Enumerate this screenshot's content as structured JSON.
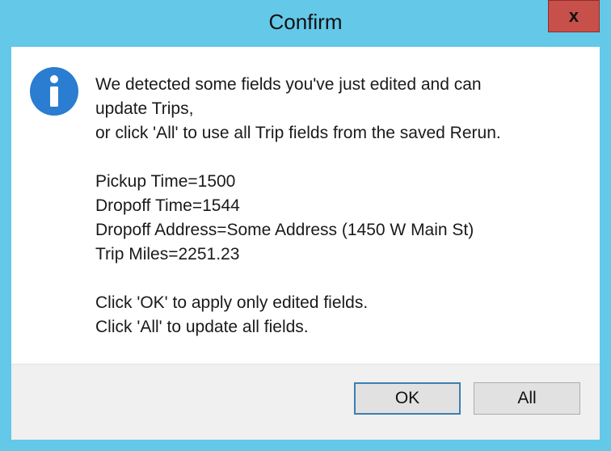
{
  "window": {
    "title": "Confirm",
    "close_glyph": "x"
  },
  "icon": {
    "name": "info-icon",
    "color": "#2a7dd1"
  },
  "message": {
    "line1": "We detected some fields you've just edited and can",
    "line2": "update Trips,",
    "line3": "or click 'All' to use all Trip fields from the saved Rerun.",
    "fields": [
      "Pickup Time=1500",
      "Dropoff Time=1544",
      "Dropoff Address=Some Address (1450 W Main St)",
      "Trip Miles=2251.23"
    ],
    "instruction1": "Click 'OK' to apply only edited fields.",
    "instruction2": "Click 'All' to update all fields."
  },
  "buttons": {
    "ok_label": "OK",
    "all_label": "All"
  }
}
